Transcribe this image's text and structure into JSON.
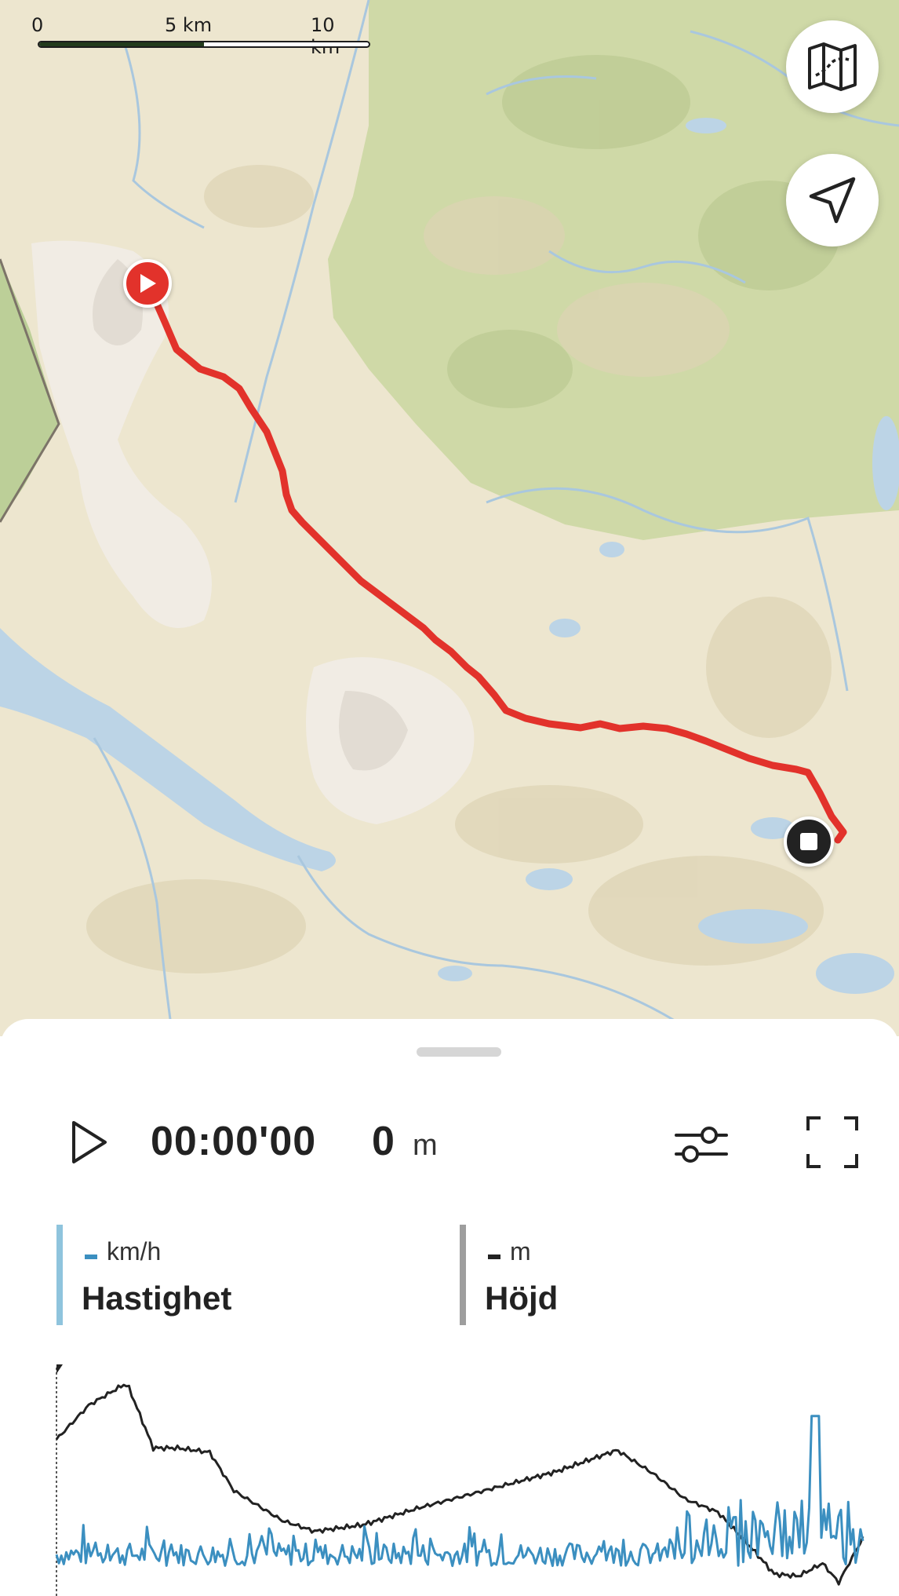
{
  "map": {
    "scale": {
      "labels": [
        "0",
        "5 km",
        "10 km"
      ]
    },
    "buttons": {
      "map_layers_icon": "folded-map-icon",
      "locate_icon": "navigation-arrow-icon"
    },
    "markers": {
      "start_icon": "play-icon",
      "end_icon": "stop-icon"
    },
    "colors": {
      "route": "#e2322b",
      "land": "#ede6cf",
      "forest": "#cfd9a7",
      "water": "#bcd4e6"
    }
  },
  "playback": {
    "play_icon": "play-icon",
    "time": "00:00'00",
    "distance_value": "0",
    "distance_unit": "m",
    "filter_icon": "sliders-icon",
    "expand_icon": "fullscreen-icon"
  },
  "metrics": [
    {
      "unit": "km/h",
      "name": "Hastighet",
      "color": "#3b8fc0",
      "bar_color": "#8fc4dd"
    },
    {
      "unit": "m",
      "name": "Höjd",
      "color": "#222222",
      "bar_color": "#9e9e9e"
    }
  ],
  "chart_data": {
    "type": "line",
    "series": [
      {
        "name": "Höjd",
        "color": "#222222"
      },
      {
        "name": "Hastighet",
        "color": "#3b8fc0"
      }
    ]
  }
}
